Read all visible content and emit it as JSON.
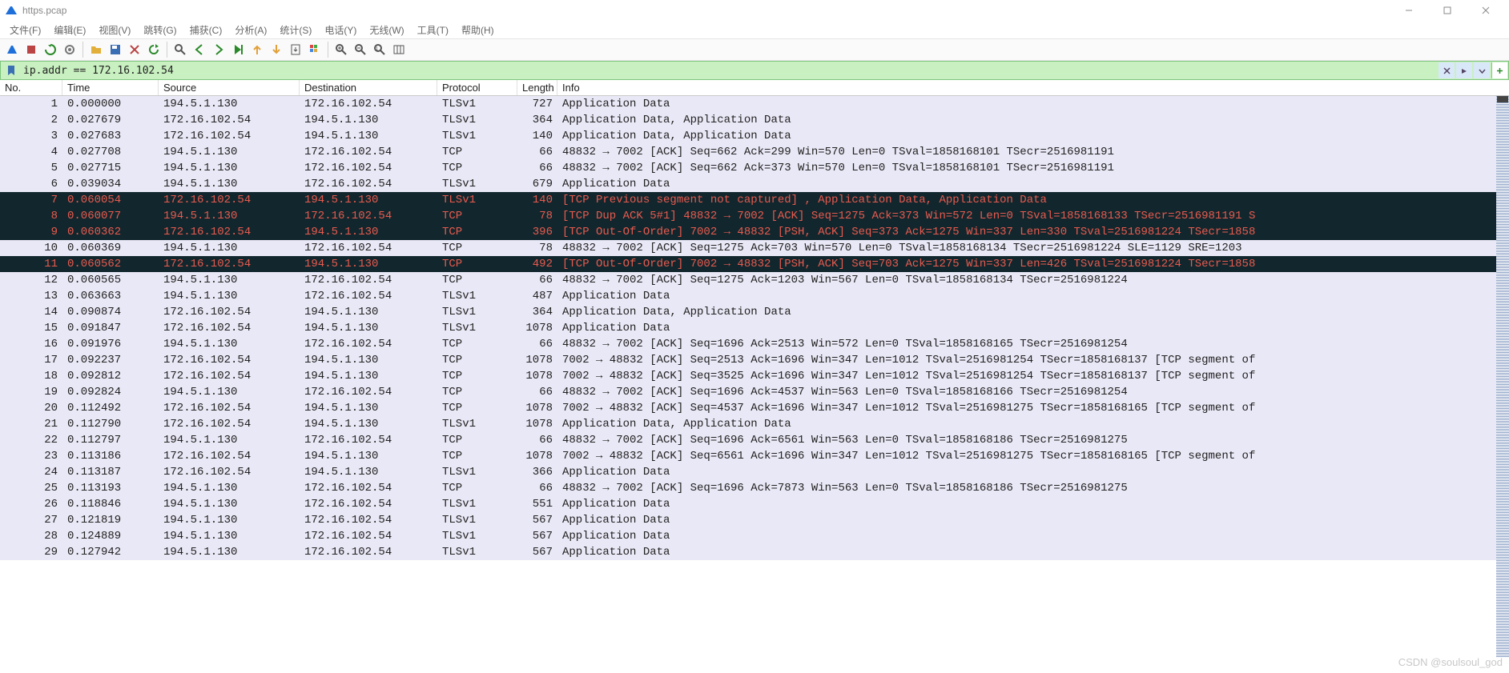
{
  "title": "https.pcap",
  "menus": [
    "文件(F)",
    "编辑(E)",
    "视图(V)",
    "跳转(G)",
    "捕获(C)",
    "分析(A)",
    "统计(S)",
    "电话(Y)",
    "无线(W)",
    "工具(T)",
    "帮助(H)"
  ],
  "filter": {
    "value": "ip.addr == 172.16.102.54"
  },
  "columns": {
    "no": "No.",
    "time": "Time",
    "source": "Source",
    "destination": "Destination",
    "protocol": "Protocol",
    "length": "Length",
    "info": "Info"
  },
  "packets": [
    {
      "no": 1,
      "time": "0.000000",
      "src": "194.5.1.130",
      "dst": "172.16.102.54",
      "proto": "TLSv1",
      "len": 727,
      "info": "Application Data",
      "cls": "normal"
    },
    {
      "no": 2,
      "time": "0.027679",
      "src": "172.16.102.54",
      "dst": "194.5.1.130",
      "proto": "TLSv1",
      "len": 364,
      "info": "Application Data, Application Data",
      "cls": "normal"
    },
    {
      "no": 3,
      "time": "0.027683",
      "src": "172.16.102.54",
      "dst": "194.5.1.130",
      "proto": "TLSv1",
      "len": 140,
      "info": "Application Data, Application Data",
      "cls": "normal"
    },
    {
      "no": 4,
      "time": "0.027708",
      "src": "194.5.1.130",
      "dst": "172.16.102.54",
      "proto": "TCP",
      "len": 66,
      "info": "48832 → 7002 [ACK] Seq=662 Ack=299 Win=570 Len=0 TSval=1858168101 TSecr=2516981191",
      "cls": "normal"
    },
    {
      "no": 5,
      "time": "0.027715",
      "src": "194.5.1.130",
      "dst": "172.16.102.54",
      "proto": "TCP",
      "len": 66,
      "info": "48832 → 7002 [ACK] Seq=662 Ack=373 Win=570 Len=0 TSval=1858168101 TSecr=2516981191",
      "cls": "normal"
    },
    {
      "no": 6,
      "time": "0.039034",
      "src": "194.5.1.130",
      "dst": "172.16.102.54",
      "proto": "TLSv1",
      "len": 679,
      "info": "Application Data",
      "cls": "normal"
    },
    {
      "no": 7,
      "time": "0.060054",
      "src": "172.16.102.54",
      "dst": "194.5.1.130",
      "proto": "TLSv1",
      "len": 140,
      "info": "[TCP Previous segment not captured] , Application Data, Application Data",
      "cls": "anomaly"
    },
    {
      "no": 8,
      "time": "0.060077",
      "src": "194.5.1.130",
      "dst": "172.16.102.54",
      "proto": "TCP",
      "len": 78,
      "info": "[TCP Dup ACK 5#1] 48832 → 7002 [ACK] Seq=1275 Ack=373 Win=572 Len=0 TSval=1858168133 TSecr=2516981191 S",
      "cls": "anomaly"
    },
    {
      "no": 9,
      "time": "0.060362",
      "src": "172.16.102.54",
      "dst": "194.5.1.130",
      "proto": "TCP",
      "len": 396,
      "info": "[TCP Out-Of-Order] 7002 → 48832 [PSH, ACK] Seq=373 Ack=1275 Win=337 Len=330 TSval=2516981224 TSecr=1858",
      "cls": "anomaly"
    },
    {
      "no": 10,
      "time": "0.060369",
      "src": "194.5.1.130",
      "dst": "172.16.102.54",
      "proto": "TCP",
      "len": 78,
      "info": "48832 → 7002 [ACK] Seq=1275 Ack=703 Win=570 Len=0 TSval=1858168134 TSecr=2516981224 SLE=1129 SRE=1203",
      "cls": "normal"
    },
    {
      "no": 11,
      "time": "0.060562",
      "src": "172.16.102.54",
      "dst": "194.5.1.130",
      "proto": "TCP",
      "len": 492,
      "info": "[TCP Out-Of-Order] 7002 → 48832 [PSH, ACK] Seq=703 Ack=1275 Win=337 Len=426 TSval=2516981224 TSecr=1858",
      "cls": "anomaly"
    },
    {
      "no": 12,
      "time": "0.060565",
      "src": "194.5.1.130",
      "dst": "172.16.102.54",
      "proto": "TCP",
      "len": 66,
      "info": "48832 → 7002 [ACK] Seq=1275 Ack=1203 Win=567 Len=0 TSval=1858168134 TSecr=2516981224",
      "cls": "normal"
    },
    {
      "no": 13,
      "time": "0.063663",
      "src": "194.5.1.130",
      "dst": "172.16.102.54",
      "proto": "TLSv1",
      "len": 487,
      "info": "Application Data",
      "cls": "normal"
    },
    {
      "no": 14,
      "time": "0.090874",
      "src": "172.16.102.54",
      "dst": "194.5.1.130",
      "proto": "TLSv1",
      "len": 364,
      "info": "Application Data, Application Data",
      "cls": "normal"
    },
    {
      "no": 15,
      "time": "0.091847",
      "src": "172.16.102.54",
      "dst": "194.5.1.130",
      "proto": "TLSv1",
      "len": 1078,
      "info": "Application Data",
      "cls": "normal"
    },
    {
      "no": 16,
      "time": "0.091976",
      "src": "194.5.1.130",
      "dst": "172.16.102.54",
      "proto": "TCP",
      "len": 66,
      "info": "48832 → 7002 [ACK] Seq=1696 Ack=2513 Win=572 Len=0 TSval=1858168165 TSecr=2516981254",
      "cls": "normal"
    },
    {
      "no": 17,
      "time": "0.092237",
      "src": "172.16.102.54",
      "dst": "194.5.1.130",
      "proto": "TCP",
      "len": 1078,
      "info": "7002 → 48832 [ACK] Seq=2513 Ack=1696 Win=347 Len=1012 TSval=2516981254 TSecr=1858168137 [TCP segment of",
      "cls": "normal"
    },
    {
      "no": 18,
      "time": "0.092812",
      "src": "172.16.102.54",
      "dst": "194.5.1.130",
      "proto": "TCP",
      "len": 1078,
      "info": "7002 → 48832 [ACK] Seq=3525 Ack=1696 Win=347 Len=1012 TSval=2516981254 TSecr=1858168137 [TCP segment of",
      "cls": "normal"
    },
    {
      "no": 19,
      "time": "0.092824",
      "src": "194.5.1.130",
      "dst": "172.16.102.54",
      "proto": "TCP",
      "len": 66,
      "info": "48832 → 7002 [ACK] Seq=1696 Ack=4537 Win=563 Len=0 TSval=1858168166 TSecr=2516981254",
      "cls": "normal"
    },
    {
      "no": 20,
      "time": "0.112492",
      "src": "172.16.102.54",
      "dst": "194.5.1.130",
      "proto": "TCP",
      "len": 1078,
      "info": "7002 → 48832 [ACK] Seq=4537 Ack=1696 Win=347 Len=1012 TSval=2516981275 TSecr=1858168165 [TCP segment of",
      "cls": "normal"
    },
    {
      "no": 21,
      "time": "0.112790",
      "src": "172.16.102.54",
      "dst": "194.5.1.130",
      "proto": "TLSv1",
      "len": 1078,
      "info": "Application Data, Application Data",
      "cls": "normal"
    },
    {
      "no": 22,
      "time": "0.112797",
      "src": "194.5.1.130",
      "dst": "172.16.102.54",
      "proto": "TCP",
      "len": 66,
      "info": "48832 → 7002 [ACK] Seq=1696 Ack=6561 Win=563 Len=0 TSval=1858168186 TSecr=2516981275",
      "cls": "normal"
    },
    {
      "no": 23,
      "time": "0.113186",
      "src": "172.16.102.54",
      "dst": "194.5.1.130",
      "proto": "TCP",
      "len": 1078,
      "info": "7002 → 48832 [ACK] Seq=6561 Ack=1696 Win=347 Len=1012 TSval=2516981275 TSecr=1858168165 [TCP segment of",
      "cls": "normal"
    },
    {
      "no": 24,
      "time": "0.113187",
      "src": "172.16.102.54",
      "dst": "194.5.1.130",
      "proto": "TLSv1",
      "len": 366,
      "info": "Application Data",
      "cls": "normal"
    },
    {
      "no": 25,
      "time": "0.113193",
      "src": "194.5.1.130",
      "dst": "172.16.102.54",
      "proto": "TCP",
      "len": 66,
      "info": "48832 → 7002 [ACK] Seq=1696 Ack=7873 Win=563 Len=0 TSval=1858168186 TSecr=2516981275",
      "cls": "normal"
    },
    {
      "no": 26,
      "time": "0.118846",
      "src": "194.5.1.130",
      "dst": "172.16.102.54",
      "proto": "TLSv1",
      "len": 551,
      "info": "Application Data",
      "cls": "normal"
    },
    {
      "no": 27,
      "time": "0.121819",
      "src": "194.5.1.130",
      "dst": "172.16.102.54",
      "proto": "TLSv1",
      "len": 567,
      "info": "Application Data",
      "cls": "normal"
    },
    {
      "no": 28,
      "time": "0.124889",
      "src": "194.5.1.130",
      "dst": "172.16.102.54",
      "proto": "TLSv1",
      "len": 567,
      "info": "Application Data",
      "cls": "normal"
    },
    {
      "no": 29,
      "time": "0.127942",
      "src": "194.5.1.130",
      "dst": "172.16.102.54",
      "proto": "TLSv1",
      "len": 567,
      "info": "Application Data",
      "cls": "normal"
    }
  ],
  "watermark": "CSDN @soulsoul_god"
}
